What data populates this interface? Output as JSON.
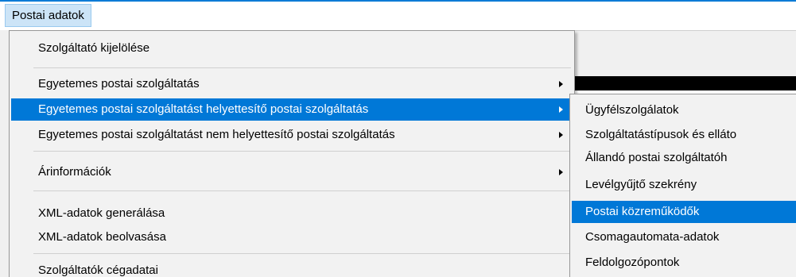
{
  "menubar": {
    "title": "Postai adatok"
  },
  "menu": {
    "items": [
      {
        "label": "Szolgáltató kijelölése"
      },
      {
        "label": "Egyetemes postai szolgáltatás"
      },
      {
        "label": "Egyetemes postai szolgáltatást helyettesítő postai szolgáltatás"
      },
      {
        "label": "Egyetemes postai szolgáltatást nem helyettesítő postai szolgáltatás"
      },
      {
        "label": "Árinformációk"
      },
      {
        "label": "XML-adatok generálása"
      },
      {
        "label": "XML-adatok beolvasása"
      },
      {
        "label": "Szolgáltatók cégadatai"
      }
    ]
  },
  "submenu": {
    "items": [
      {
        "label": "Ügyfélszolgálatok"
      },
      {
        "label": "Szolgáltatástípusok és elláto"
      },
      {
        "label": "Állandó postai szolgáltatóh"
      },
      {
        "label": "Levélgyűjtő szekrény"
      },
      {
        "label": "Postai közreműködők"
      },
      {
        "label": "Csomagautomata-adatok"
      },
      {
        "label": "Feldolgozópontok"
      }
    ]
  },
  "colors": {
    "selection": "#0078d7",
    "menu_background": "#f2f2f2",
    "menubar_highlight": "#cce4f7"
  },
  "icons": {
    "submenu_arrow": "chevron-right-icon"
  }
}
